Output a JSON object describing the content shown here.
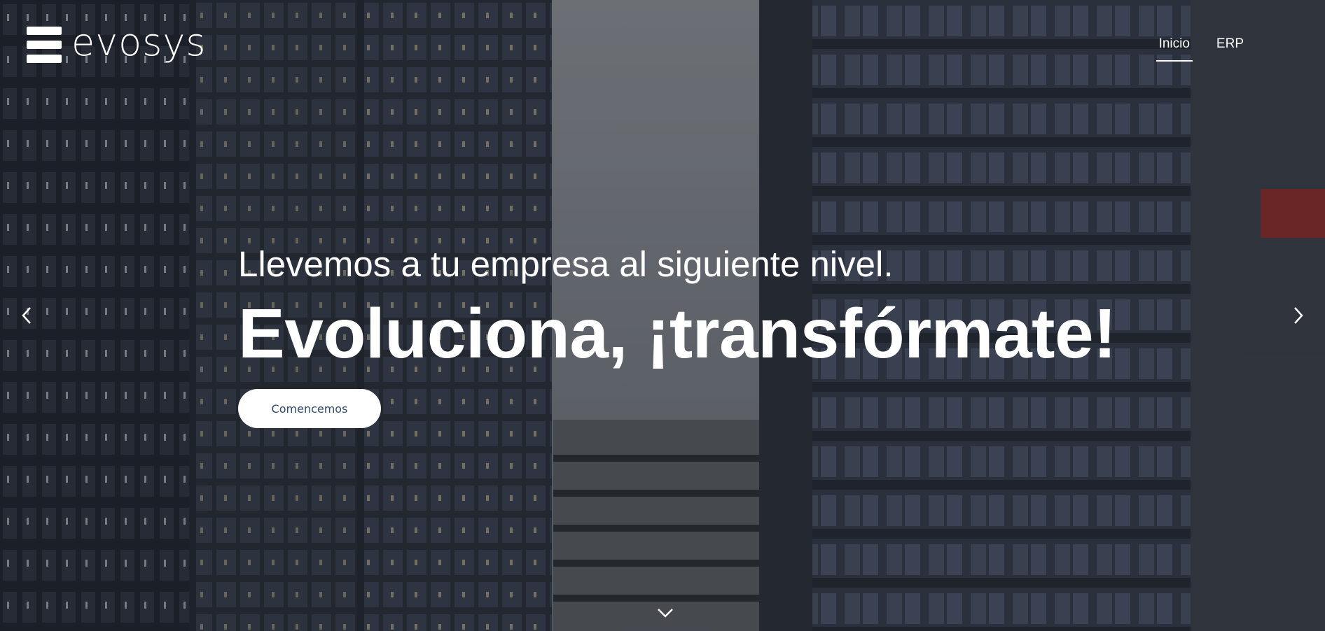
{
  "header": {
    "logo_text": "evosys",
    "nav": [
      {
        "label": "Inicio",
        "active": true
      },
      {
        "label": "ERP",
        "active": false
      }
    ]
  },
  "hero": {
    "subtitle": "Llevemos a tu empresa al siguiente nivel.",
    "title": "Evoluciona, ¡transfórmate!",
    "cta_label": "Comencemos"
  },
  "icons": {
    "prev": "chevron-left-icon",
    "next": "chevron-right-icon",
    "scroll": "chevron-down-icon"
  },
  "colors": {
    "cta_text": "#2b4a6f",
    "cta_bg": "#ffffff"
  }
}
